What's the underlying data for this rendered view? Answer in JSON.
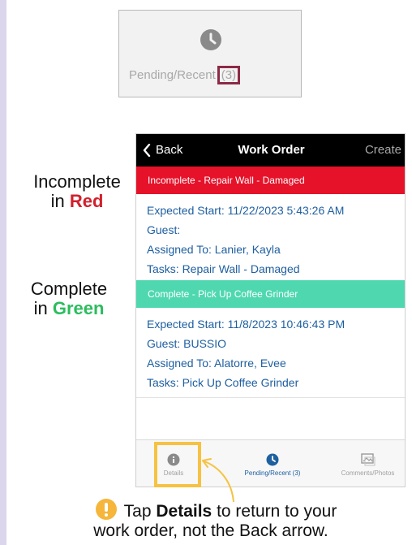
{
  "top_crop": {
    "label": "Pending/Recent",
    "count": "(3)"
  },
  "side_labels": {
    "incomplete_prefix": "Incomplete",
    "incomplete_in": "in",
    "incomplete_color": "Red",
    "complete_prefix": "Complete",
    "complete_in": "in",
    "complete_color": "Green"
  },
  "nav": {
    "back": "Back",
    "title": "Work Order",
    "create": "Create"
  },
  "orders": [
    {
      "band": "Incomplete - Repair Wall - Damaged",
      "expected_start": "Expected Start: 11/22/2023 5:43:26 AM",
      "guest": "Guest:",
      "assigned": "Assigned To: Lanier, Kayla",
      "tasks": "Tasks: Repair Wall - Damaged"
    },
    {
      "band": "Complete - Pick Up Coffee Grinder",
      "expected_start": "Expected Start: 11/8/2023 10:46:43 PM",
      "guest": "Guest: BUSSIO",
      "assigned": "Assigned To: Alatorre, Evee",
      "tasks": "Tasks: Pick Up Coffee Grinder"
    }
  ],
  "tabs": {
    "details": "Details",
    "pending": "Pending/Recent (3)",
    "comments": "Comments/Photos"
  },
  "tip": {
    "pre": "Tap ",
    "bold": "Details",
    "post": " to return to your",
    "line2": "work order, not the Back arrow."
  },
  "colors": {
    "incomplete": "#e5122a",
    "complete": "#4fd8b0",
    "highlight": "#f5c242",
    "link": "#1e5fa0"
  }
}
